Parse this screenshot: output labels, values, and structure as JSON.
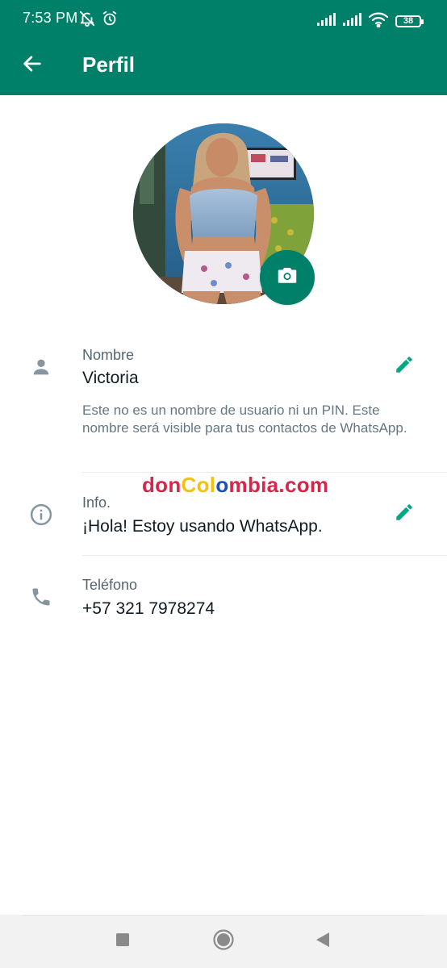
{
  "status_bar": {
    "time": "7:53 PM",
    "battery": "38",
    "icons": [
      "muted-bell-icon",
      "alarm-icon",
      "signal-icon",
      "signal-icon",
      "wifi-icon",
      "battery-icon"
    ]
  },
  "app_bar": {
    "title": "Perfil",
    "back_icon": "arrow-left-icon"
  },
  "avatar": {
    "camera_icon": "camera-icon"
  },
  "name": {
    "label": "Nombre",
    "value": "Victoria",
    "hint": "Este no es un nombre de usuario ni un PIN. Este nombre será visible para tus contactos de WhatsApp.",
    "icon": "person-icon",
    "edit_icon": "pencil-icon"
  },
  "info": {
    "label": "Info.",
    "value": "¡Hola! Estoy usando WhatsApp.",
    "icon": "info-icon",
    "edit_icon": "pencil-icon"
  },
  "phone": {
    "label": "Teléfono",
    "value": "+57 321 7978274",
    "icon": "phone-icon"
  },
  "watermark": {
    "part1": "don",
    "part2": "Col",
    "part3": "o",
    "part4": "mbia.com"
  },
  "nav": {
    "icons": [
      "recents-square-icon",
      "home-circle-icon",
      "back-triangle-icon"
    ]
  },
  "colors": {
    "primary": "#008069",
    "accent": "#00a884",
    "icon_gray": "#8696a0",
    "label_gray": "#54656f",
    "text": "#111b21"
  }
}
